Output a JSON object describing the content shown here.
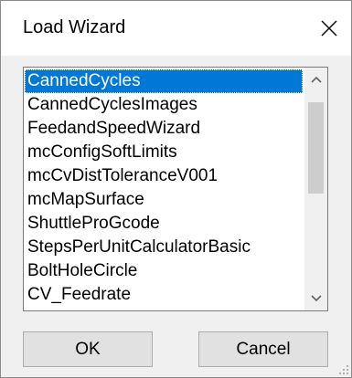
{
  "window": {
    "title": "Load Wizard",
    "close_icon": "close-icon"
  },
  "list": {
    "selected_index": 0,
    "items": [
      "CannedCycles",
      "CannedCyclesImages",
      "FeedandSpeedWizard",
      "mcConfigSoftLimits",
      "mcCvDistToleranceV001",
      "mcMapSurface",
      "ShuttleProGcode",
      "StepsPerUnitCalculatorBasic",
      "BoltHoleCircle",
      "CV_Feedrate"
    ],
    "scroll_up_icon": "chevron-up-icon",
    "scroll_down_icon": "chevron-down-icon"
  },
  "buttons": {
    "ok_label": "OK",
    "cancel_label": "Cancel"
  },
  "colors": {
    "selection": "#0078d7",
    "dialog_bg": "#f0f0f0",
    "button_bg": "#e1e1e1"
  }
}
